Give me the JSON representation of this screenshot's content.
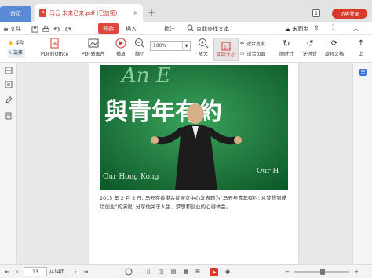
{
  "tabs": {
    "home_label": "首页",
    "doc_title": "马云 未来已来.pdf (已加密)",
    "doc_icon_text": "P",
    "close_glyph": "×",
    "add_glyph": "+",
    "count_badge": "1",
    "visitor_label": "访客登录"
  },
  "menu": {
    "file_label": "文件",
    "start_label": "开始",
    "insert_label": "插入",
    "annotate_label": "批注",
    "search_label": "点此查找文本",
    "sync_label": "未同步"
  },
  "toolbar": {
    "hand_label": "手型",
    "select_label": "选择",
    "pdf_to_office_label": "PDF转Office",
    "pdf_to_image_label": "PDF转图片",
    "play_label": "播放",
    "zoom_out_label": "缩小",
    "zoom_value": "100%",
    "zoom_in_label": "放大",
    "actual_size_label": "实际大小",
    "fit_width_label": "适合宽度",
    "fit_page_label": "适合页面",
    "rotate_ccw_label": "顺时针",
    "rotate_cw_label": "逆时针",
    "rotate_doc_label": "旋转文档",
    "prev_label": "上"
  },
  "document": {
    "banner_text_1": "An E",
    "banner_text_2": "與青年有約",
    "bottom_left_text": "Our Hong Kong",
    "bottom_right_text": "Our H",
    "caption": "2015 年 2 月 2 日, 马云在香港会议展览中心发表题为“马云与青年有约: 从梦想到成功创业”的演说, 分享他关于人生、梦想和创业的心得体会。"
  },
  "statusbar": {
    "current_page": "13",
    "total_pages": "/414页"
  },
  "colors": {
    "accent_red": "#d9382d",
    "home_tab_blue": "#5b8bd6",
    "banner_green": "#1f6b3a"
  }
}
